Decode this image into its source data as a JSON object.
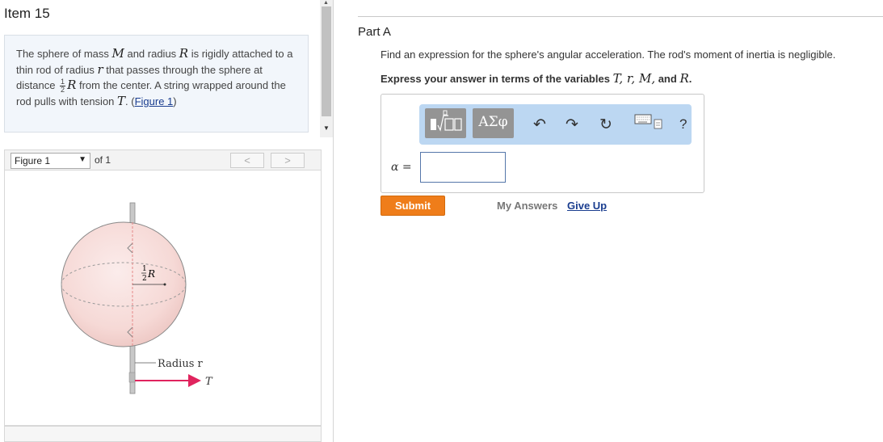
{
  "item": {
    "title": "Item 15"
  },
  "problem": {
    "t1": "The sphere of mass ",
    "M": "M",
    "t2": " and radius ",
    "R": "R",
    "t3": " is rigidly attached to a thin rod of radius ",
    "r": "r",
    "t4": " that passes through the sphere at distance ",
    "frac_num": "1",
    "frac_den": "2",
    "R2": "R",
    "t5": " from the center. A string wrapped around the rod pulls with tension ",
    "T": "T",
    "t6": ". (",
    "link": "Figure 1",
    "t7": ")"
  },
  "figure_nav": {
    "select_value": "Figure 1",
    "of_text": "of 1",
    "prev": "<",
    "next": ">"
  },
  "figure": {
    "half_num": "1",
    "half_den": "2",
    "half_R": "R",
    "radius_label": "Radius r",
    "tension_label": "T"
  },
  "part": {
    "title": "Part A",
    "question": "Find an expression for the sphere's angular acceleration. The rod's moment of inertia is negligible.",
    "express_prefix": "Express your answer in terms of the variables ",
    "express_vars": "T, r, M,",
    "express_and": " and ",
    "express_last": "R",
    "express_end": "."
  },
  "toolbar": {
    "greek_label": "ΑΣφ",
    "undo": "↶",
    "redo": "↷",
    "reset": "↻",
    "help": "?"
  },
  "answer": {
    "label": "α =",
    "value": ""
  },
  "actions": {
    "submit": "Submit",
    "my_answers": "My Answers",
    "give_up": "Give Up"
  }
}
